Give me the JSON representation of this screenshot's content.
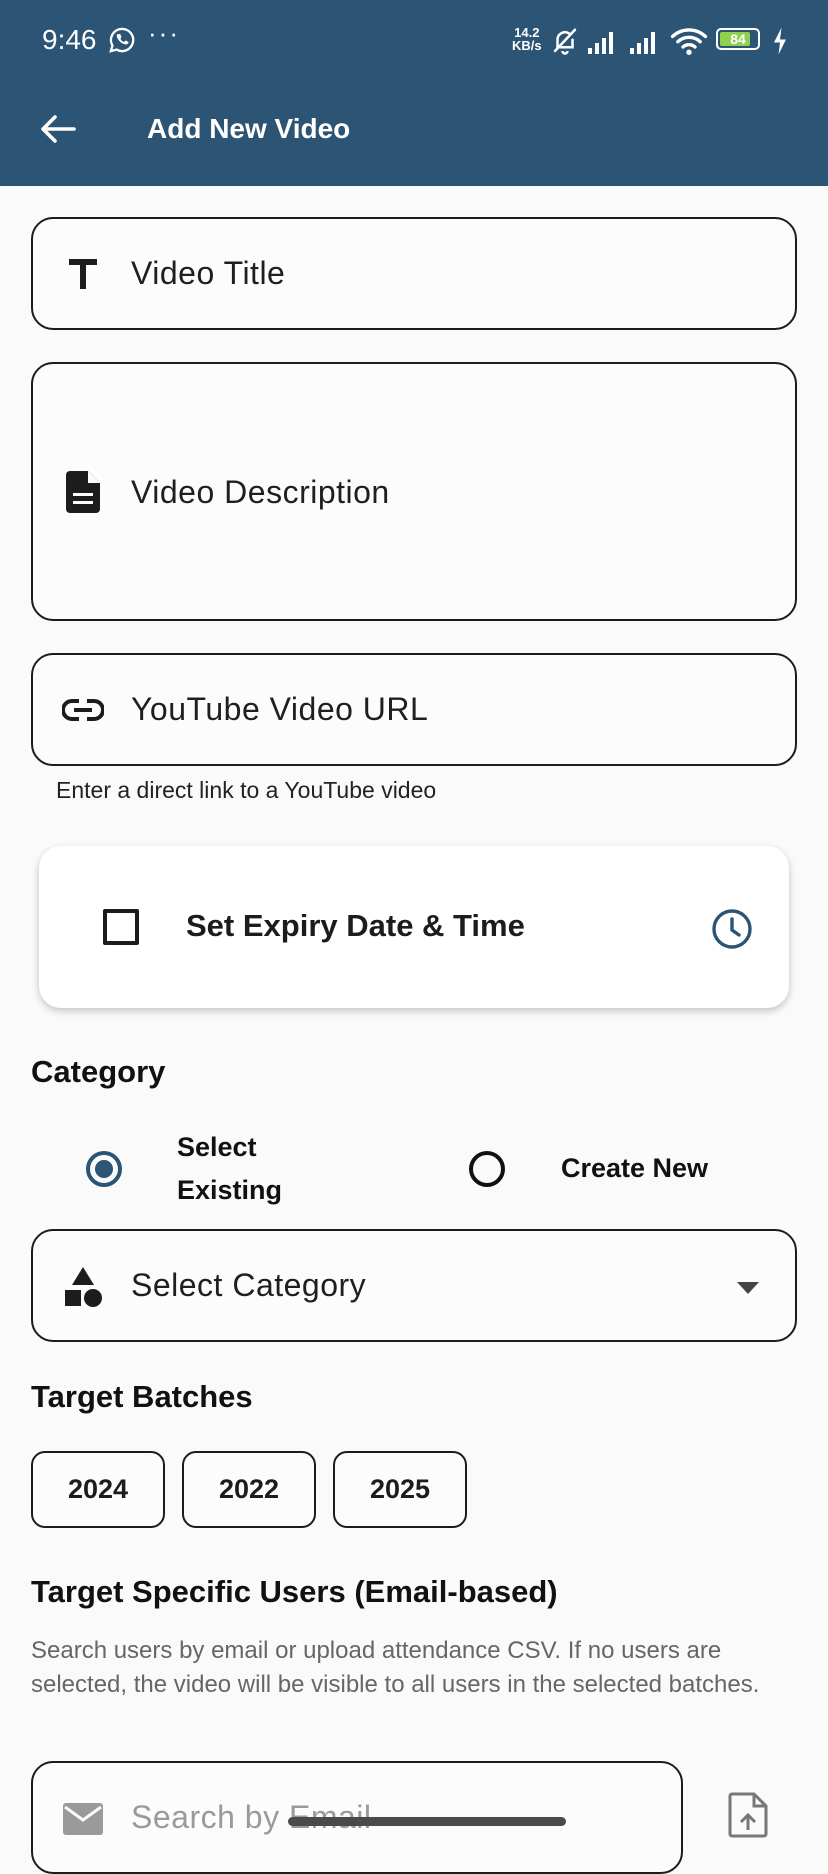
{
  "status_bar": {
    "time": "9:46",
    "dots": "···",
    "net_speed_value": "14.2",
    "net_speed_unit": "KB/s",
    "battery_level": 84,
    "battery_label": "84"
  },
  "app_bar": {
    "title": "Add New Video"
  },
  "form": {
    "video_title_placeholder": "Video Title",
    "video_description_placeholder": "Video Description",
    "youtube_url_placeholder": "YouTube Video URL",
    "youtube_url_helper": "Enter a direct link to a YouTube video",
    "expiry_label": "Set Expiry Date & Time",
    "expiry_checked": false
  },
  "category": {
    "section_title": "Category",
    "options": [
      {
        "label_line1": "Select",
        "label_line2": "Existing",
        "selected": true
      },
      {
        "label": "Create New",
        "selected": false
      }
    ],
    "dropdown_placeholder": "Select Category"
  },
  "target_batches": {
    "section_title": "Target Batches",
    "chips": [
      "2024",
      "2022",
      "2025"
    ]
  },
  "target_users": {
    "section_title": "Target Specific Users (Email-based)",
    "description": "Search users by email or upload attendance CSV. If no users are selected, the video will be visible to all users in the selected batches.",
    "search_placeholder": "Search by Email"
  },
  "colors": {
    "app_bar": "#2c5474",
    "accent": "#2c5474",
    "border": "#1c1c1c",
    "background": "#fafafa"
  }
}
